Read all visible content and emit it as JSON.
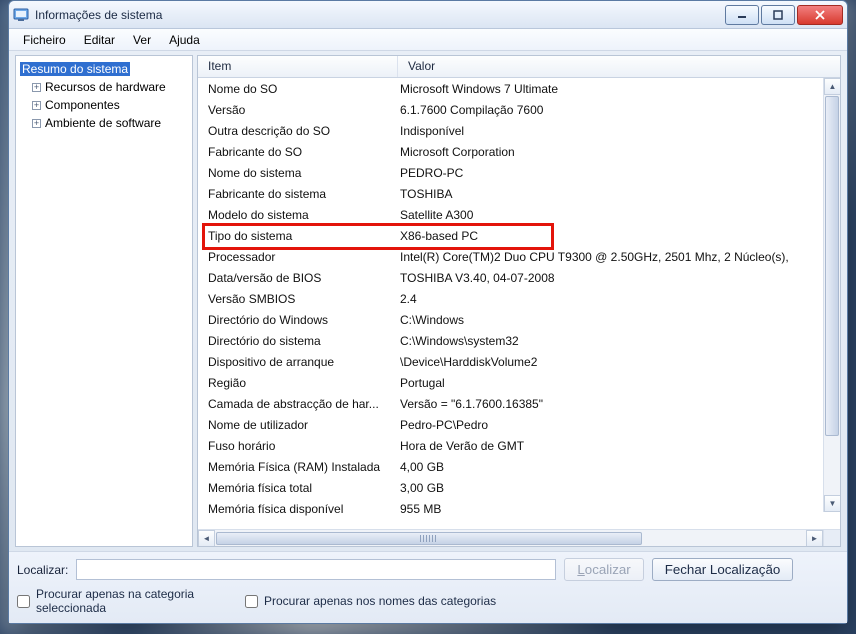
{
  "window": {
    "title": "Informações de sistema"
  },
  "menu": {
    "items": [
      "Ficheiro",
      "Editar",
      "Ver",
      "Ajuda"
    ]
  },
  "tree": {
    "root_label": "Resumo do sistema",
    "children": [
      {
        "label": "Recursos de hardware"
      },
      {
        "label": "Componentes"
      },
      {
        "label": "Ambiente de software"
      }
    ]
  },
  "columns": {
    "item": "Item",
    "value": "Valor"
  },
  "rows": [
    {
      "item": "Nome do SO",
      "value": "Microsoft Windows 7 Ultimate"
    },
    {
      "item": "Versão",
      "value": "6.1.7600 Compilação 7600"
    },
    {
      "item": "Outra descrição do SO",
      "value": "Indisponível"
    },
    {
      "item": "Fabricante do SO",
      "value": "Microsoft Corporation"
    },
    {
      "item": "Nome do sistema",
      "value": "PEDRO-PC"
    },
    {
      "item": "Fabricante do sistema",
      "value": "TOSHIBA"
    },
    {
      "item": "Modelo do sistema",
      "value": "Satellite A300"
    },
    {
      "item": "Tipo do sistema",
      "value": "X86-based PC"
    },
    {
      "item": "Processador",
      "value": "Intel(R) Core(TM)2 Duo CPU     T9300  @ 2.50GHz, 2501 Mhz, 2 Núcleo(s),"
    },
    {
      "item": "Data/versão de BIOS",
      "value": "TOSHIBA V3.40, 04-07-2008"
    },
    {
      "item": "Versão SMBIOS",
      "value": "2.4"
    },
    {
      "item": "Directório do Windows",
      "value": "C:\\Windows"
    },
    {
      "item": "Directório do sistema",
      "value": "C:\\Windows\\system32"
    },
    {
      "item": "Dispositivo de arranque",
      "value": "\\Device\\HarddiskVolume2"
    },
    {
      "item": "Região",
      "value": "Portugal"
    },
    {
      "item": "Camada de abstracção de har...",
      "value": "Versão = \"6.1.7600.16385\""
    },
    {
      "item": "Nome de utilizador",
      "value": "Pedro-PC\\Pedro"
    },
    {
      "item": "Fuso horário",
      "value": "Hora de Verão de GMT"
    },
    {
      "item": "Memória Física (RAM) Instalada",
      "value": "4,00 GB"
    },
    {
      "item": "Memória física total",
      "value": "3,00 GB"
    },
    {
      "item": "Memória física disponível",
      "value": "955 MB"
    }
  ],
  "footer": {
    "find_label": "Localizar:",
    "find_btn": "Localizar",
    "close_btn": "Fechar Localização",
    "check1": "Procurar apenas na categoria seleccionada",
    "check2": "Procurar apenas nos nomes das categorias"
  },
  "highlight_row_index": 7
}
